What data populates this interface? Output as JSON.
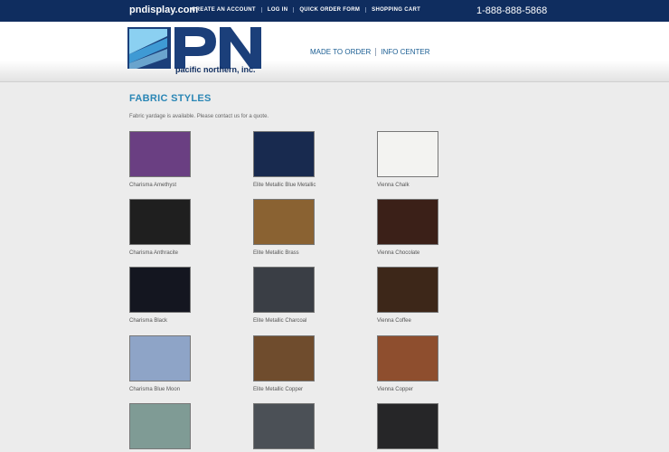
{
  "topbar": {
    "site": "pndisplay.com",
    "links": [
      "CREATE AN ACCOUNT",
      "LOG IN",
      "QUICK ORDER FORM",
      "SHOPPING CART"
    ],
    "phone": "1-888-888-5868"
  },
  "logo": {
    "letters": "PN",
    "subtitle": "pacific northern, inc.",
    "color": "#1b3f7a"
  },
  "nav": [
    "MADE TO ORDER",
    "INFO CENTER"
  ],
  "page": {
    "title": "FABRIC STYLES",
    "note": "Fabric yardage is available. Please contact us for a quote."
  },
  "swatches": [
    {
      "name": "Charisma Amethyst",
      "color": "#6a3f82"
    },
    {
      "name": "Elite Metallic Blue Metallic",
      "color": "#182a4f"
    },
    {
      "name": "Vienna Chalk",
      "color": "#f3f3f1"
    },
    {
      "name": "Charisma Anthracite",
      "color": "#1f1f1f"
    },
    {
      "name": "Elite Metallic Brass",
      "color": "#8a6232"
    },
    {
      "name": "Vienna Chocolate",
      "color": "#3b2018"
    },
    {
      "name": "Charisma Black",
      "color": "#141620"
    },
    {
      "name": "Elite Metallic Charcoal",
      "color": "#3a3e45"
    },
    {
      "name": "Vienna Coffee",
      "color": "#3d2719"
    },
    {
      "name": "Charisma Blue Moon",
      "color": "#8ea4c7"
    },
    {
      "name": "Elite Metallic Copper",
      "color": "#6f4c2d"
    },
    {
      "name": "Vienna Copper",
      "color": "#8e4e2e"
    },
    {
      "name": "",
      "color": "#7f9b95"
    },
    {
      "name": "",
      "color": "#4b5056"
    },
    {
      "name": "",
      "color": "#262628"
    }
  ]
}
